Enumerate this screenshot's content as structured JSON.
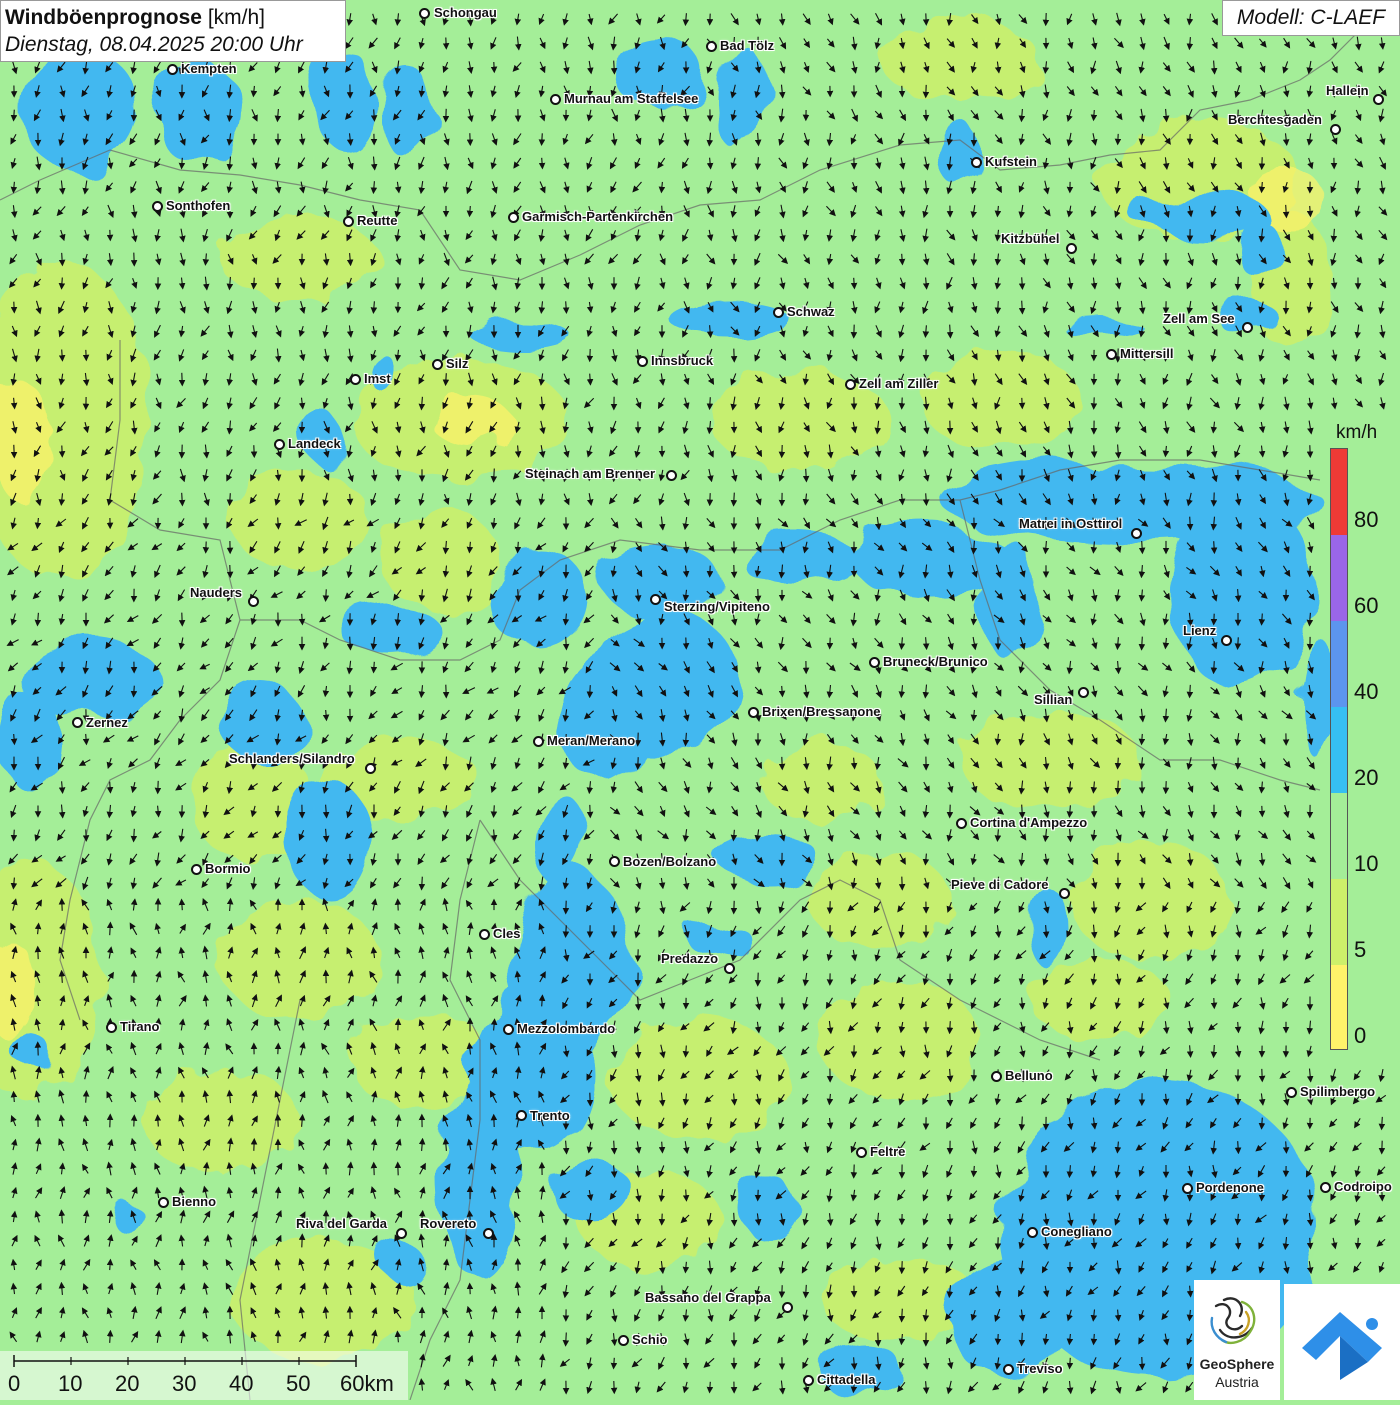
{
  "title": {
    "main": "Windböenprognose",
    "unit": "[km/h]",
    "datetime": "Dienstag, 08.04.2025 20:00 Uhr"
  },
  "model": "Modell: C-LAEF",
  "legend": {
    "unit": "km/h",
    "labels": [
      "80",
      "60",
      "40",
      "20",
      "10",
      "5",
      "0"
    ],
    "colors": [
      "#ee3a36",
      "#9a66e8",
      "#5c95ee",
      "#36bff2",
      "#a4ee98",
      "#cdf06a",
      "#fff36a"
    ]
  },
  "scalebar": {
    "labels": [
      "0",
      "10",
      "20",
      "30",
      "40",
      "50",
      "60km"
    ]
  },
  "logos": {
    "geosphere_line1": "GeoSphere",
    "geosphere_line2": "Austria"
  },
  "colors": {
    "calm": "#fff36a",
    "light": "#cdf06a",
    "moderate": "#a4ee98",
    "fresh": "#43b8f0"
  },
  "cities": [
    {
      "name": "Schongau",
      "dot": [
        424,
        13
      ],
      "label": [
        434,
        13
      ]
    },
    {
      "name": "Kempten",
      "dot": [
        172,
        69
      ],
      "label": [
        181,
        69
      ]
    },
    {
      "name": "Bad Tölz",
      "dot": [
        711,
        46
      ],
      "label": [
        720,
        46
      ]
    },
    {
      "name": "Murnau am Staffelsee",
      "dot": [
        555,
        99
      ],
      "label": [
        564,
        99
      ]
    },
    {
      "name": "Hallein",
      "dot": [
        1378,
        99
      ],
      "label": [
        1326,
        91
      ]
    },
    {
      "name": "Berchtesgaden",
      "dot": [
        1335,
        129
      ],
      "label": [
        1228,
        120
      ]
    },
    {
      "name": "Kufstein",
      "dot": [
        976,
        162
      ],
      "label": [
        985,
        162
      ]
    },
    {
      "name": "Sonthofen",
      "dot": [
        157,
        206
      ],
      "label": [
        166,
        206
      ]
    },
    {
      "name": "Reutte",
      "dot": [
        348,
        221
      ],
      "label": [
        357,
        221
      ]
    },
    {
      "name": "Garmisch-Partenkirchen",
      "dot": [
        513,
        217
      ],
      "label": [
        522,
        217
      ]
    },
    {
      "name": "Kitzbühel",
      "dot": [
        1071,
        248
      ],
      "label": [
        1001,
        239
      ]
    },
    {
      "name": "Schwaz",
      "dot": [
        778,
        312
      ],
      "label": [
        787,
        312
      ]
    },
    {
      "name": "Zell am See",
      "dot": [
        1247,
        327
      ],
      "label": [
        1163,
        319
      ]
    },
    {
      "name": "Mittersill",
      "dot": [
        1111,
        354
      ],
      "label": [
        1120,
        354
      ]
    },
    {
      "name": "Innsbruck",
      "dot": [
        642,
        361
      ],
      "label": [
        651,
        361
      ]
    },
    {
      "name": "Imst",
      "dot": [
        355,
        379
      ],
      "label": [
        364,
        379
      ]
    },
    {
      "name": "Silz",
      "dot": [
        437,
        364
      ],
      "label": [
        446,
        364
      ]
    },
    {
      "name": "Zell am Ziller",
      "dot": [
        850,
        384
      ],
      "label": [
        859,
        384
      ]
    },
    {
      "name": "Landeck",
      "dot": [
        279,
        444
      ],
      "label": [
        288,
        444
      ]
    },
    {
      "name": "Steinach am Brenner",
      "dot": [
        671,
        475
      ],
      "label": [
        525,
        474
      ]
    },
    {
      "name": "Matrei in Osttirol",
      "dot": [
        1136,
        533
      ],
      "label": [
        1019,
        524
      ]
    },
    {
      "name": "Nauders",
      "dot": [
        253,
        601
      ],
      "label": [
        190,
        593
      ]
    },
    {
      "name": "Sterzing/Vipiteno",
      "dot": [
        655,
        599
      ],
      "label": [
        664,
        607
      ]
    },
    {
      "name": "Lienz",
      "dot": [
        1226,
        640
      ],
      "label": [
        1183,
        631
      ]
    },
    {
      "name": "Bruneck/Brunico",
      "dot": [
        874,
        662
      ],
      "label": [
        883,
        662
      ]
    },
    {
      "name": "Sillian",
      "dot": [
        1083,
        692
      ],
      "label": [
        1034,
        700
      ]
    },
    {
      "name": "Brixen/Bressanone",
      "dot": [
        753,
        712
      ],
      "label": [
        762,
        712
      ]
    },
    {
      "name": "Zernez",
      "dot": [
        77,
        722
      ],
      "label": [
        86,
        723
      ]
    },
    {
      "name": "Meran/Merano",
      "dot": [
        538,
        741
      ],
      "label": [
        547,
        741
      ]
    },
    {
      "name": "Schlanders/Silandro",
      "dot": [
        370,
        768
      ],
      "label": [
        229,
        759
      ]
    },
    {
      "name": "Cortina d'Ampezzo",
      "dot": [
        961,
        823
      ],
      "label": [
        970,
        823
      ]
    },
    {
      "name": "Bozen/Bolzano",
      "dot": [
        614,
        861
      ],
      "label": [
        623,
        862
      ]
    },
    {
      "name": "Bormio",
      "dot": [
        196,
        869
      ],
      "label": [
        205,
        869
      ]
    },
    {
      "name": "Pieve di Cadore",
      "dot": [
        1064,
        893
      ],
      "label": [
        951,
        885
      ]
    },
    {
      "name": "Cles",
      "dot": [
        484,
        934
      ],
      "label": [
        493,
        934
      ]
    },
    {
      "name": "Predazzo",
      "dot": [
        729,
        968
      ],
      "label": [
        661,
        959
      ]
    },
    {
      "name": "Tirano",
      "dot": [
        111,
        1027
      ],
      "label": [
        120,
        1027
      ]
    },
    {
      "name": "Mezzolombardo",
      "dot": [
        508,
        1029
      ],
      "label": [
        517,
        1029
      ]
    },
    {
      "name": "Belluno",
      "dot": [
        996,
        1076
      ],
      "label": [
        1005,
        1076
      ]
    },
    {
      "name": "Spilimbergo",
      "dot": [
        1291,
        1092
      ],
      "label": [
        1300,
        1092
      ]
    },
    {
      "name": "Trento",
      "dot": [
        521,
        1115
      ],
      "label": [
        530,
        1116
      ]
    },
    {
      "name": "Feltre",
      "dot": [
        861,
        1152
      ],
      "label": [
        870,
        1152
      ]
    },
    {
      "name": "Pordenone",
      "dot": [
        1187,
        1188
      ],
      "label": [
        1196,
        1188
      ]
    },
    {
      "name": "Codroipo",
      "dot": [
        1325,
        1187
      ],
      "label": [
        1334,
        1187
      ]
    },
    {
      "name": "Bienno",
      "dot": [
        163,
        1202
      ],
      "label": [
        172,
        1202
      ]
    },
    {
      "name": "Riva del Garda",
      "dot": [
        401,
        1233
      ],
      "label": [
        296,
        1224
      ]
    },
    {
      "name": "Rovereto",
      "dot": [
        488,
        1233
      ],
      "label": [
        420,
        1224
      ]
    },
    {
      "name": "Conegliano",
      "dot": [
        1032,
        1232
      ],
      "label": [
        1041,
        1232
      ]
    },
    {
      "name": "Bassano del Grappa",
      "dot": [
        787,
        1307
      ],
      "label": [
        645,
        1298
      ]
    },
    {
      "name": "Schio",
      "dot": [
        623,
        1340
      ],
      "label": [
        632,
        1340
      ]
    },
    {
      "name": "Treviso",
      "dot": [
        1008,
        1369
      ],
      "label": [
        1017,
        1369
      ]
    },
    {
      "name": "Cittadella",
      "dot": [
        808,
        1380
      ],
      "label": [
        817,
        1380
      ]
    }
  ]
}
